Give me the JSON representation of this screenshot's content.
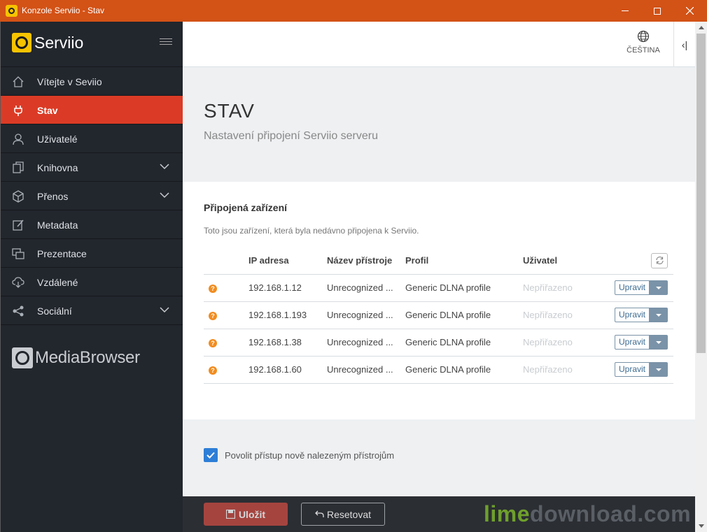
{
  "window": {
    "title": "Konzole Serviio - Stav"
  },
  "sidebar": {
    "logo_text": "Serviio",
    "items": [
      {
        "label": "Vítejte v Seviio",
        "icon": "home-icon",
        "active": false,
        "has_children": false
      },
      {
        "label": "Stav",
        "icon": "plug-icon",
        "active": true,
        "has_children": false
      },
      {
        "label": "Uživatelé",
        "icon": "user-icon",
        "active": false,
        "has_children": false
      },
      {
        "label": "Knihovna",
        "icon": "library-icon",
        "active": false,
        "has_children": true
      },
      {
        "label": "Přenos",
        "icon": "cube-icon",
        "active": false,
        "has_children": true
      },
      {
        "label": "Metadata",
        "icon": "edit-icon",
        "active": false,
        "has_children": false
      },
      {
        "label": "Prezentace",
        "icon": "presentation-icon",
        "active": false,
        "has_children": false
      },
      {
        "label": "Vzdálené",
        "icon": "cloud-download-icon",
        "active": false,
        "has_children": false
      },
      {
        "label": "Sociální",
        "icon": "share-icon",
        "active": false,
        "has_children": true
      }
    ],
    "mediabrowser_text": "MediaBrowser"
  },
  "topbar": {
    "language": "ČEŠTINA",
    "collapse_glyph": "‹|"
  },
  "page": {
    "title": "STAV",
    "subtitle": "Nastavení připojení Serviio serveru"
  },
  "devices": {
    "section_title": "Připojená zařízení",
    "description": "Toto jsou zařízení, která byla nedávno připojena k Serviio.",
    "columns": [
      "IP adresa",
      "Název přístroje",
      "Profil",
      "Uživatel"
    ],
    "rows": [
      {
        "ip": "192.168.1.12",
        "name": "Unrecognized ...",
        "profile": "Generic DLNA profile",
        "user": "Nepřiřazeno",
        "action": "Upravit"
      },
      {
        "ip": "192.168.1.193",
        "name": "Unrecognized ...",
        "profile": "Generic DLNA profile",
        "user": "Nepřiřazeno",
        "action": "Upravit"
      },
      {
        "ip": "192.168.1.38",
        "name": "Unrecognized ...",
        "profile": "Generic DLNA profile",
        "user": "Nepřiřazeno",
        "action": "Upravit"
      },
      {
        "ip": "192.168.1.60",
        "name": "Unrecognized ...",
        "profile": "Generic DLNA profile",
        "user": "Nepřiřazeno",
        "action": "Upravit"
      }
    ],
    "status_icon": "question-icon"
  },
  "options": {
    "allow_new_devices_label": "Povolit přístup nově nalezeným přístrojům",
    "allow_new_devices_checked": true
  },
  "footer": {
    "save_label": "Uložit",
    "reset_label": "Resetovat",
    "watermark_lime": "lime",
    "watermark_rest": "download.com"
  },
  "colors": {
    "titlebar": "#d35216",
    "sidebar_bg": "#22262d",
    "active_item": "#db3b26",
    "accent_blue": "#2d7ed6",
    "status_orange": "#f28c1f"
  }
}
